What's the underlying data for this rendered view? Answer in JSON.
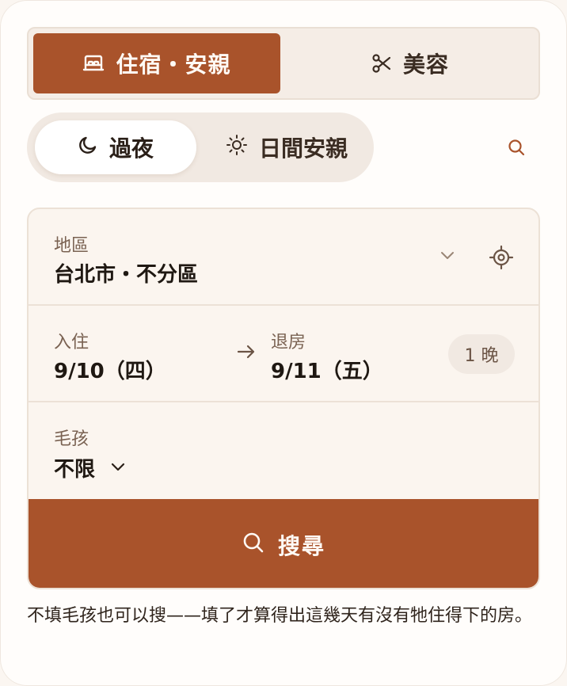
{
  "tabs": {
    "lodging_label": "住宿・安親",
    "beauty_label": "美容"
  },
  "mode": {
    "overnight_label": "過夜",
    "daycare_label": "日間安親"
  },
  "region": {
    "label": "地區",
    "value": "台北市・不分區"
  },
  "dates": {
    "checkin_label": "入住",
    "checkin_value": "9/10（四）",
    "checkout_label": "退房",
    "checkout_value": "9/11（五）",
    "nights_label": "1 晚"
  },
  "pets": {
    "label": "毛孩",
    "value": "不限"
  },
  "search_button_label": "搜尋",
  "hint_text": "不填毛孩也可以搜——填了才算得出這幾天有沒有牠住得下的房。",
  "colors": {
    "accent": "#a9532b",
    "panel_bg": "#fbf5ef",
    "segment_bg": "#f5ede6"
  },
  "icons": {
    "lodging": "bed-icon",
    "beauty": "scissors-icon",
    "overnight": "moon-icon",
    "daycare": "sun-icon",
    "search": "search-icon",
    "region_dropdown": "chevron-down-icon",
    "locate": "locate-icon",
    "date_arrow": "arrow-right-icon",
    "pets_dropdown": "chevron-down-icon"
  }
}
